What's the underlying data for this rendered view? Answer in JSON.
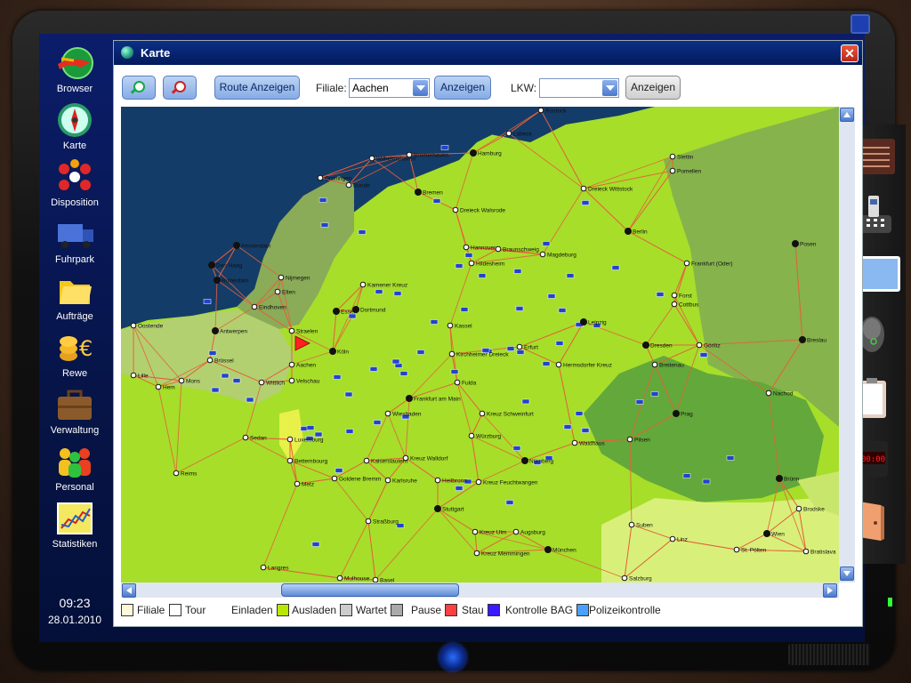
{
  "window": {
    "title": "Karte"
  },
  "sidebar": {
    "items": [
      {
        "label": "Browser",
        "icon": "browser-icon"
      },
      {
        "label": "Karte",
        "icon": "map-compass-icon"
      },
      {
        "label": "Disposition",
        "icon": "disposition-icon"
      },
      {
        "label": "Fuhrpark",
        "icon": "truck-icon"
      },
      {
        "label": "Aufträge",
        "icon": "folder-icon"
      },
      {
        "label": "Rewe",
        "icon": "money-icon"
      },
      {
        "label": "Verwaltung",
        "icon": "briefcase-icon"
      },
      {
        "label": "Personal",
        "icon": "people-icon"
      },
      {
        "label": "Statistiken",
        "icon": "chart-icon"
      }
    ],
    "clock": {
      "time": "09:23",
      "date": "28.01.2010"
    }
  },
  "toolbar": {
    "route_button": "Route Anzeigen",
    "filiale_label": "Filiale:",
    "filiale_value": "Aachen",
    "filiale_show": "Anzeigen",
    "lkw_label": "LKW:",
    "lkw_value": "",
    "lkw_show": "Anzeigen"
  },
  "legend": [
    {
      "label": "Filiale",
      "color": "#fff8d8"
    },
    {
      "label": "Tour",
      "color": "#ffffff"
    },
    {
      "label": "Einladen",
      "color": "#b8e800"
    },
    {
      "label": "Ausladen",
      "color": "#cccccc"
    },
    {
      "label": "Wartet",
      "color": "#aaaaaa"
    },
    {
      "label": "Pause",
      "color": "#ff4040"
    },
    {
      "label": "Stau",
      "color": "#3a1aff"
    },
    {
      "label": "Kontrolle BAG",
      "color": "#4aa0ff"
    },
    {
      "label": "Polizeikontrolle",
      "color": ""
    }
  ],
  "map": {
    "cities": [
      "Rostock",
      "Lübeck",
      "Hamburg",
      "Wilhelmshaven",
      "Bremerhaven",
      "Bunde",
      "Groningen",
      "Stettin",
      "Pomellen",
      "Dreieck Wittstock",
      "Bremen",
      "Dreieck Walsrode",
      "Berlin",
      "Amsterdam",
      "Den Haag",
      "Rotterdam",
      "Nijmegen",
      "Hannover",
      "Braunschweig",
      "Magdeburg",
      "Hildesheim",
      "Frankfurt (Oder)",
      "Posen",
      "Forst",
      "Cottbus",
      "Kamener Kreuz",
      "Elten",
      "Eindhoven",
      "Essen",
      "Dortmund",
      "Kassel",
      "Leipzig",
      "Antwerpen",
      "Oostende",
      "Straelen",
      "Köln",
      "Kirchheimer Dreieck",
      "Erfurt",
      "Dresden",
      "Görlitz",
      "Breslau",
      "Brüssel",
      "Aachen",
      "Lille",
      "Mons",
      "Hermsdorfer Kreuz",
      "Breitenau",
      "Hem",
      "Wittlich",
      "Velschau",
      "Fulda",
      "Nachod",
      "Frankfurt am Main",
      "Wiesbaden",
      "Kreuz Schweinfurt",
      "Prag",
      "Luxemburg",
      "Würzburg",
      "Waidhaus",
      "Pilsen",
      "Sedan",
      "Bettembourg",
      "Kaiserslautern",
      "Kreuz Walldorf",
      "Nürnberg",
      "Brünn",
      "Reims",
      "Goldene Bremm",
      "Karlsruhe",
      "Heilbronn",
      "Kreuz Feuchtwangen",
      "Metz",
      "Stuttgart",
      "Straßburg",
      "Augsburg",
      "Brodske",
      "Kreuz Ulm",
      "Linz",
      "Wien",
      "Kreuz Memmingen",
      "München",
      "Suben",
      "St. Pölten",
      "Bratislava",
      "Langres",
      "Mulhouse",
      "Basel",
      "Salzburg"
    ]
  }
}
